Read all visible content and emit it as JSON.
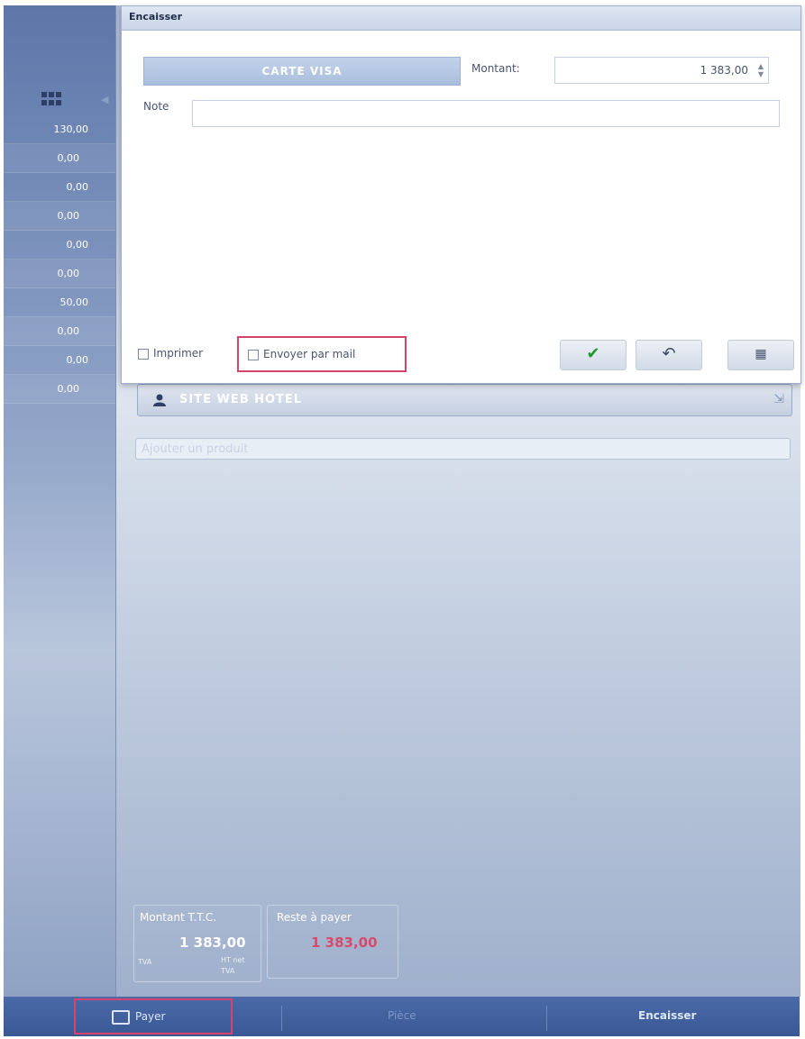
{
  "sidebar": {
    "rows": [
      "130,00",
      "0,00",
      "0,00",
      "0,00",
      "0,00",
      "0,00",
      "50,00",
      "0,00",
      "0,00",
      "0,00"
    ]
  },
  "client": {
    "name": "SITE WEB HOTEL"
  },
  "product_search": {
    "placeholder": "Ajouter un produit"
  },
  "totals": {
    "total_label": "Montant T.T.C.",
    "total_value": "1 383,00",
    "mini_left": "TVA",
    "mini_right_1": "HT net",
    "mini_right_2": "TVA",
    "to_pay_label": "Reste à payer",
    "to_pay_value": "1 383,00"
  },
  "bottom": {
    "pay_label": "Payer",
    "mid_label": "Pièce",
    "right_label": "Encaisser"
  },
  "dialog": {
    "title": "Encaisser",
    "method": "CARTE VISA",
    "amount_label": "Montant:",
    "amount_value": "1 383,00",
    "note_label": "Note",
    "print_label": "Imprimer",
    "email_label": "Envoyer par mail",
    "ok_symbol": "✔",
    "undo_symbol": "↶",
    "cal_symbol": "▦"
  },
  "colors": {
    "accent": "#d8436a",
    "sidebar": "#5e76a8",
    "ok": "#1a9a28"
  }
}
